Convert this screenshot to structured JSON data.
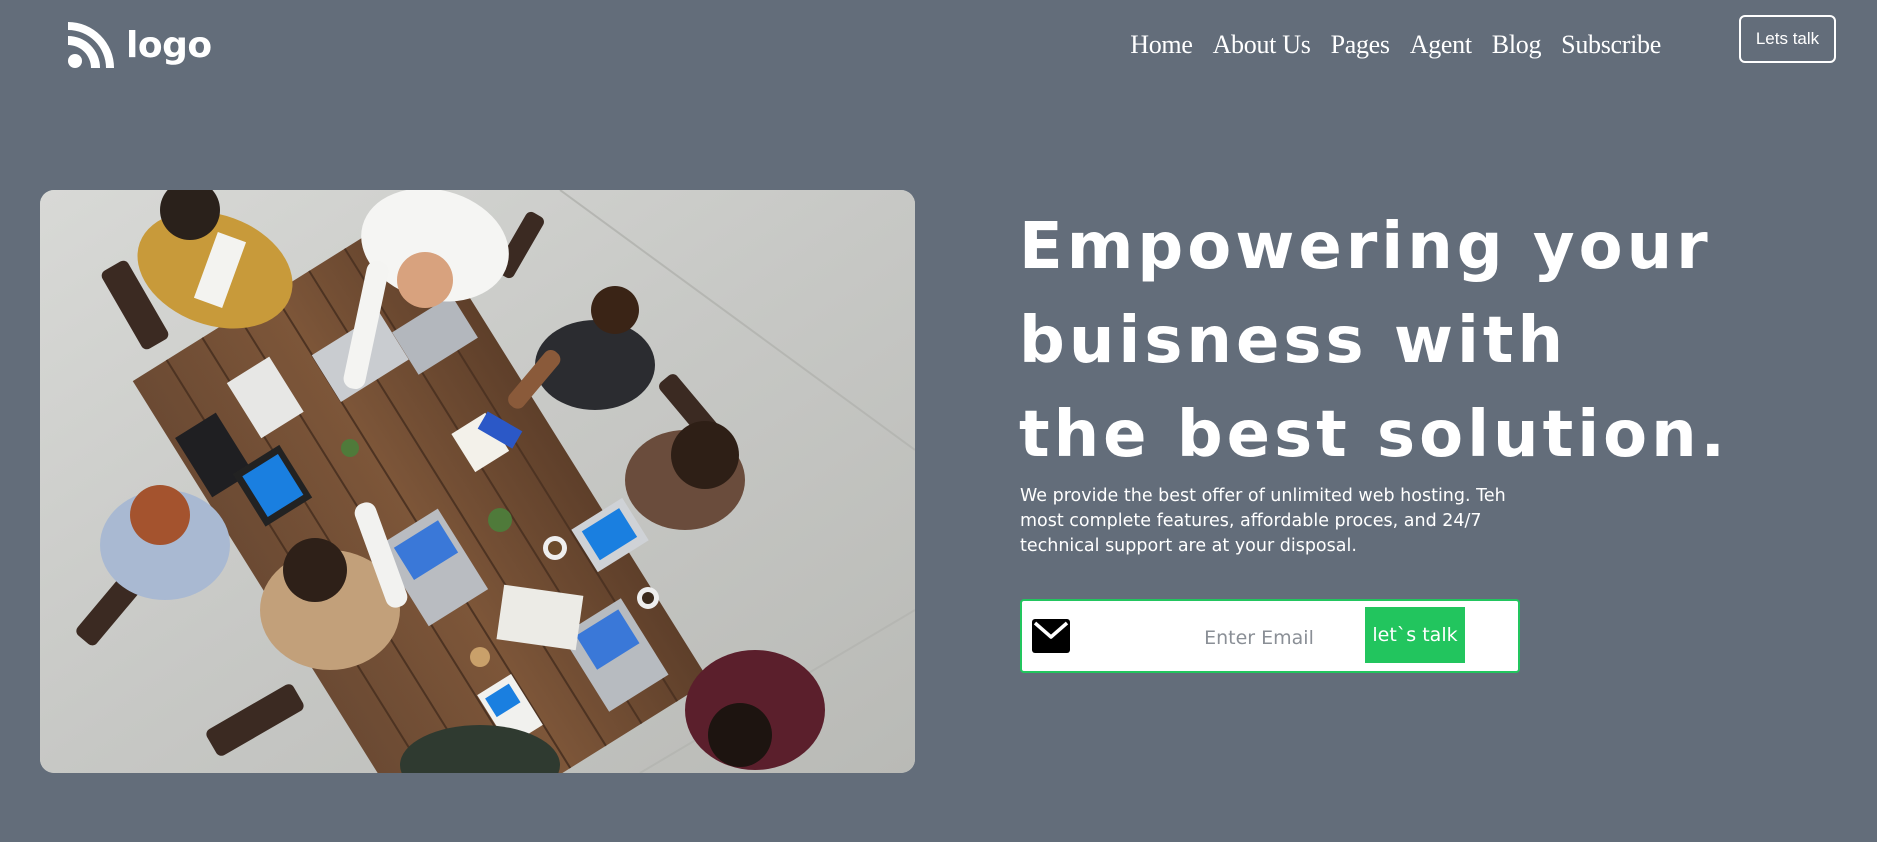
{
  "header": {
    "logo_text": "logo",
    "nav": [
      {
        "label": "Home"
      },
      {
        "label": "About Us"
      },
      {
        "label": "Pages"
      },
      {
        "label": "Agent"
      },
      {
        "label": "Blog"
      },
      {
        "label": "Subscribe"
      }
    ],
    "cta_label": "Lets talk"
  },
  "hero": {
    "headline_lines": [
      "Empowering your",
      "buisness with",
      "the best solution."
    ],
    "description": "We provide the best offer of unlimited web hosting. Teh most complete features, affordable proces, and 24/7 technical support are at your disposal.",
    "email_form": {
      "placeholder": "Enter Email",
      "button_label": "let`s talk"
    }
  },
  "theme": {
    "background": "#636d7a",
    "accent": "#22c55e",
    "text": "#ffffff"
  },
  "icons": {
    "logo": "rss-feed-icon",
    "email": "envelope-icon"
  }
}
